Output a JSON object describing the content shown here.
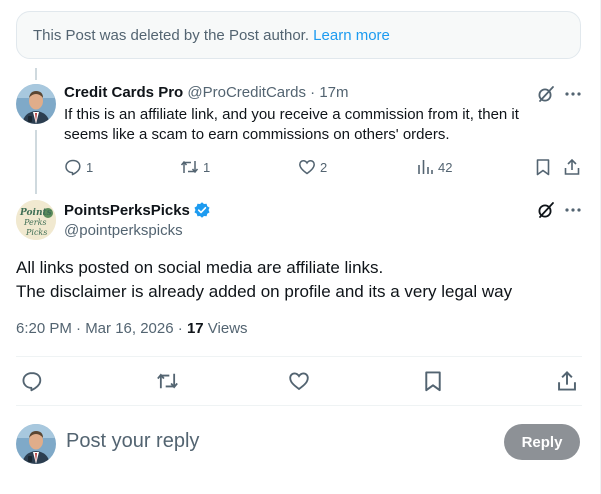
{
  "deleted_notice": {
    "text": "This Post was deleted by the Post author.",
    "link": "Learn more"
  },
  "reply": {
    "author_name": "Credit Cards Pro",
    "author_handle": "@ProCreditCards",
    "separator": "·",
    "time": "17m",
    "text_line1": "If this is an affiliate link, and you receive a commission from it, then it",
    "text_line2": "seems like a scam to earn commissions on others' orders.",
    "stats": {
      "replies": "1",
      "reposts": "1",
      "likes": "2",
      "views": "42"
    },
    "icons": [
      "grok-icon",
      "more-icon",
      "reply-icon",
      "repost-icon",
      "like-icon",
      "views-icon",
      "bookmark-icon",
      "share-icon"
    ]
  },
  "main_post": {
    "author_name": "PointsPerksPicks",
    "author_handle": "@pointperkspicks",
    "avatar_text": [
      "Points",
      "Perks",
      "Picks"
    ],
    "verified": true,
    "text_line1": "All links posted on social media are affiliate links.",
    "text_line2": "The disclaimer is already added on profile and its a very legal way",
    "timestamp": "6:20 PM · Mar 16, 2026",
    "separator": " · ",
    "views_count": "17",
    "views_label": " Views"
  },
  "composer": {
    "placeholder": "Post your reply",
    "button_label": "Reply"
  },
  "colors": {
    "accent": "#1d9bf0",
    "text_primary": "#0f1419",
    "text_secondary": "#536471",
    "reply_button_disabled": "#8d9196"
  }
}
